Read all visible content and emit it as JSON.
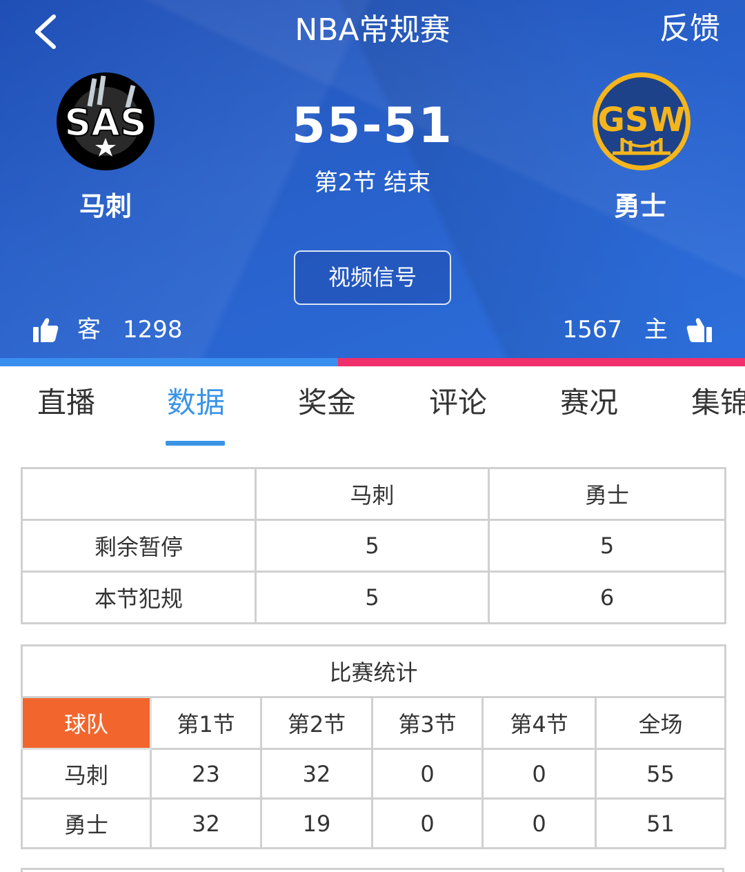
{
  "header": {
    "title": "NBA常规赛",
    "feedback_label": "反馈",
    "score": "55-51",
    "status": "第2节 结束",
    "video_button_label": "视频信号",
    "away_team": {
      "name": "马刺",
      "logo_text": "SAS"
    },
    "home_team": {
      "name": "勇士",
      "logo_text": "GSW"
    },
    "away_likes": {
      "label": "客",
      "count": "1298"
    },
    "home_likes": {
      "label": "主",
      "count": "1567"
    },
    "support_bar": {
      "away_share": 0.4537,
      "away_color": "#3a8ef0",
      "home_color": "#f0306c"
    }
  },
  "tabs": [
    {
      "label": "直播",
      "active": false
    },
    {
      "label": "数据",
      "active": true
    },
    {
      "label": "奖金",
      "active": false
    },
    {
      "label": "评论",
      "active": false
    },
    {
      "label": "赛况",
      "active": false
    },
    {
      "label": "集锦",
      "active": false
    }
  ],
  "info_table": {
    "columns": [
      "",
      "马刺",
      "勇士"
    ],
    "rows": [
      {
        "label": "剩余暂停",
        "away": "5",
        "home": "5"
      },
      {
        "label": "本节犯规",
        "away": "5",
        "home": "6"
      }
    ]
  },
  "stats_table": {
    "caption": "比赛统计",
    "columns": [
      "球队",
      "第1节",
      "第2节",
      "第3节",
      "第4节",
      "全场"
    ],
    "rows": [
      {
        "team": "马刺",
        "q1": "23",
        "q2": "32",
        "q3": "0",
        "q4": "0",
        "total": "55"
      },
      {
        "team": "勇士",
        "q1": "32",
        "q2": "19",
        "q3": "0",
        "q4": "0",
        "total": "51"
      }
    ]
  },
  "colors": {
    "header_blue": "#2860c9",
    "active_tab": "#3a94e6",
    "team_header_orange": "#f2662e",
    "gsw_gold": "#f5b51c",
    "gsw_blue": "#1d428a"
  }
}
